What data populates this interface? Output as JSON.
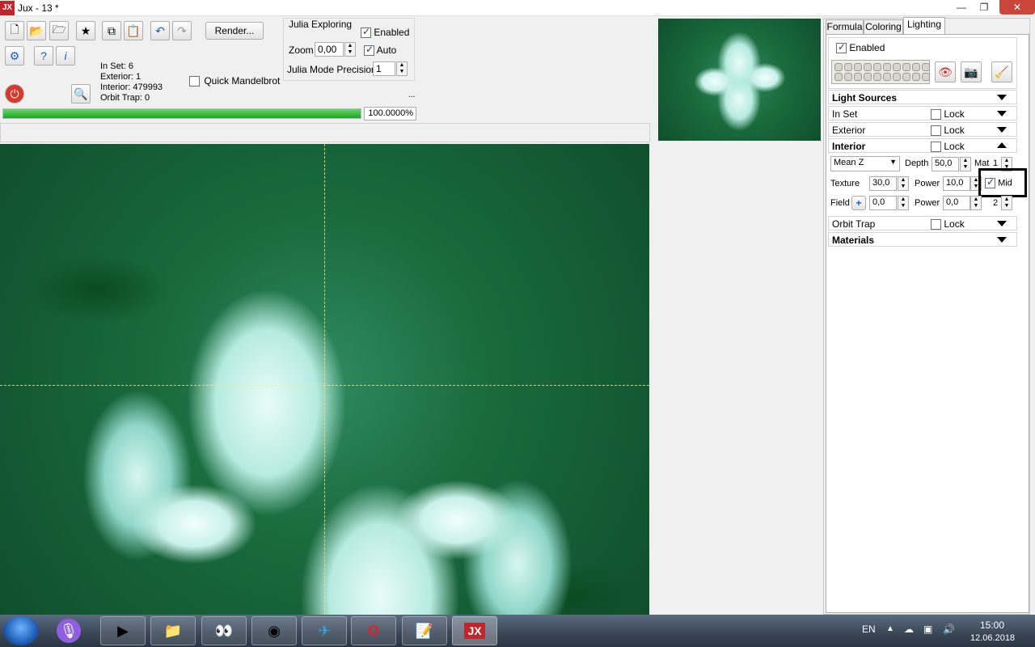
{
  "window": {
    "title": "Jux - 13 *",
    "logo": "JX"
  },
  "toolbar": {
    "icons": [
      "new-file-icon",
      "open-folder-icon",
      "open-recent-icon",
      "save-icon",
      "copy-icon",
      "paste-icon",
      "undo-icon",
      "redo-icon",
      "settings-icon",
      "help-icon",
      "info-icon",
      "power-icon",
      "zoom-icon"
    ],
    "render_label": "Render..."
  },
  "stats": {
    "in_set": "In Set: 6",
    "exterior": "Exterior: 1",
    "interior": "Interior: 479993",
    "orbit_trap": "Orbit Trap: 0"
  },
  "quick_mandelbrot": {
    "label": "Quick Mandelbrot",
    "checked": false
  },
  "julia": {
    "title": "Julia Exploring",
    "enabled_label": "Enabled",
    "enabled": true,
    "zoom_label": "Zoom",
    "zoom_value": "0,00",
    "auto_label": "Auto",
    "auto": true,
    "precision_label": "Julia Mode Precision",
    "precision_value": "1",
    "ellipsis": "..."
  },
  "progress": {
    "value_text": "100.0000%",
    "fraction": 1.0
  },
  "tabs": [
    "Formula",
    "Coloring",
    "Lighting"
  ],
  "active_tab": "Lighting",
  "lighting": {
    "enabled_label": "Enabled",
    "enabled": true,
    "sections": {
      "light_sources": "Light Sources",
      "in_set": "In Set",
      "exterior": "Exterior",
      "interior": "Interior",
      "orbit_trap": "Orbit Trap",
      "materials": "Materials"
    },
    "lock_label": "Lock",
    "interior_panel": {
      "mode": "Mean Z",
      "depth_label": "Depth",
      "depth_value": "50,0",
      "mat_label": "Mat",
      "mat_value": "1",
      "texture_label": "Texture",
      "texture_value": "30,0",
      "power_label": "Power",
      "power_value": "10,0",
      "mid_label": "Mid",
      "mid_checked": true,
      "field_label": "Field",
      "field_value": "0,0",
      "power2_label": "Power",
      "power2_value": "0,0",
      "mat2_value": "2"
    }
  },
  "taskbar": {
    "apps": [
      "microphone-icon",
      "media-player-icon",
      "file-explorer-icon",
      "eyes-app-icon",
      "chrome-icon",
      "telegram-icon",
      "opera-icon",
      "notes-icon",
      "jux-icon"
    ],
    "language": "EN",
    "time": "15:00",
    "date": "12.06.2018"
  }
}
